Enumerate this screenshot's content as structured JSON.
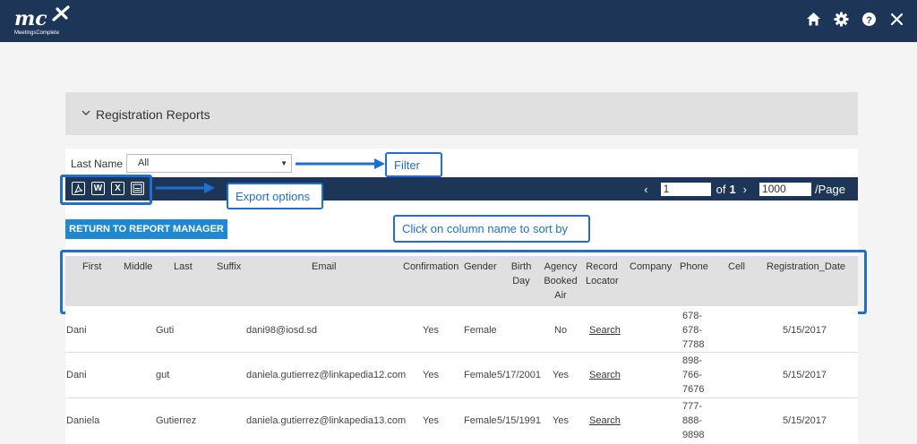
{
  "app": {
    "logo_text": "mc",
    "logo_subtext": "MeetingsComplete"
  },
  "top_icons": [
    "home-icon",
    "gear-icon",
    "help-icon",
    "close-icon"
  ],
  "panel": {
    "title": "Registration Reports"
  },
  "filter": {
    "label": "Last Name",
    "value": "All"
  },
  "callouts": {
    "filter": "Filter",
    "export": "Export options",
    "sort": "Click on column name to sort by"
  },
  "pager": {
    "page": "1",
    "of_label": "of",
    "total": "1",
    "per_page": "1000",
    "per_page_label": "/Page"
  },
  "return_button": "RETURN TO REPORT MANAGER",
  "columns": [
    "First",
    "Middle",
    "Last",
    "Suffix",
    "Email",
    "Confirmation",
    "Gender",
    "Birth Day",
    "Agency Booked Air",
    "Record Locator",
    "Company",
    "Phone",
    "Cell",
    "Registration_Date"
  ],
  "rows": [
    {
      "first": "Dani",
      "last": "Guti",
      "email": "dani98@iosd.sd",
      "confirmation": "Yes",
      "gender": "Female",
      "birthday": "",
      "agency": "No",
      "locator": "Search",
      "phone": "678-\n678-\n7788",
      "reg_date": "5/15/2017"
    },
    {
      "first": "Dani",
      "last": "gut",
      "email": "daniela.gutierrez@linkapedia12.com",
      "confirmation": "Yes",
      "gender": "Female",
      "birthday": "5/17/2001",
      "agency": "Yes",
      "locator": "Search",
      "phone": "898-\n766-\n7676",
      "reg_date": "5/15/2017"
    },
    {
      "first": "Daniela",
      "last": "Gutierrez",
      "email": "daniela.gutierrez@linkapedia13.com",
      "confirmation": "Yes",
      "gender": "Female",
      "birthday": "5/15/1991",
      "agency": "Yes",
      "locator": "Search",
      "phone": "777-\n888-\n9898",
      "reg_date": "5/15/2017"
    }
  ],
  "colors": {
    "navy": "#1d3557",
    "accent": "#1e6fd1",
    "button": "#1e88d2"
  }
}
